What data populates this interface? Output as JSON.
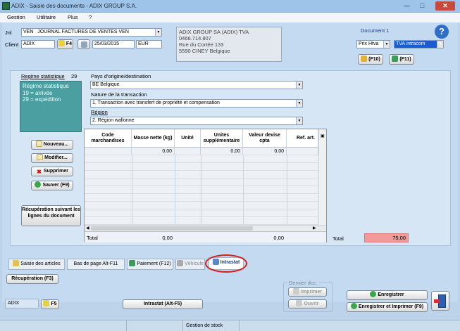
{
  "window": {
    "title": "ADIX - Saisie des documents - ADIX GROUP S.A."
  },
  "menu": [
    "Gestion",
    "Utilitaire",
    "Plus",
    "?"
  ],
  "header": {
    "jnl_label": "Jnl",
    "jnl_code": "VEN",
    "jnl_name": "JOURNAL FACTURES DE VENTES  VEN",
    "client_label": "Client",
    "client_code": "ADIX",
    "f4_label": "F4",
    "date": "25/03/2015",
    "currency": "EUR",
    "address": [
      "ADIX GROUP SA  (ADIX) TVA",
      "0466.714.807",
      "Rue du Cortée 133",
      "5590 CINEY Belgique"
    ],
    "document_label": "Document 1",
    "price_type": "Prix Htva",
    "vat_type": "TVA intracom",
    "f10_label": "(F10)",
    "f11_label": "(F11)"
  },
  "intrastat": {
    "regime_label": "Regime statistique",
    "regime_value": "29",
    "regime_help": [
      "Régime statistique",
      "19 = arrivée",
      "29 = expédition"
    ],
    "pays_label": "Pays d'origine/destination",
    "pays_value": "BE Belgique",
    "nature_label": "Nature de la transaction",
    "nature_value": "1. Transaction avec transfert de propriété et compensation",
    "region_label": "Région",
    "region_value": "2. Région wallonne"
  },
  "side_buttons": {
    "nouveau": "Nouveau...",
    "modifier": "Modifier...",
    "supprimer": "Supprimer",
    "sauver": "Sauver (F9)",
    "recuperation_lignes": "Récupération suivant les lignes du document"
  },
  "grid": {
    "columns": [
      "Code marchandises",
      "Masse nette (kg)",
      "Unité",
      "Unites supplémentaire",
      "Valeur devise cpta",
      "Ref. art."
    ],
    "rows": [
      [
        "",
        "0,00",
        "",
        "0,00",
        "0,00",
        ""
      ]
    ],
    "total_label": "Total",
    "total_values": [
      "0,00",
      "0,00"
    ]
  },
  "total_box": {
    "label": "Total",
    "value": "75,00"
  },
  "tabs": [
    "Saisie des articles",
    "Bas de page Alt-F11",
    "Paiement (F12)",
    "Véhicule",
    "Intrastat"
  ],
  "bottom": {
    "recuperation": "Récupération (F3)",
    "dernier_doc": "Dernier doc.",
    "imprimer": "Imprimer",
    "ouvrir": "Ouvrir",
    "enregistrer": "Enregistrer",
    "enregistrer_imprimer": "Enregistrer et Imprimer (F9)",
    "user_code": "ADIX",
    "f5_label": "F5",
    "intrastat_button": "Intrastat (Alt-F5)"
  },
  "statusbar": {
    "text": "Gestion de stock"
  },
  "colors": {
    "highlight_ring": "#d21f1f",
    "total_value_bg": "#f29a9a",
    "vat_field_bg": "#1c5bd6",
    "regime_help_bg": "#4b9fa1"
  }
}
